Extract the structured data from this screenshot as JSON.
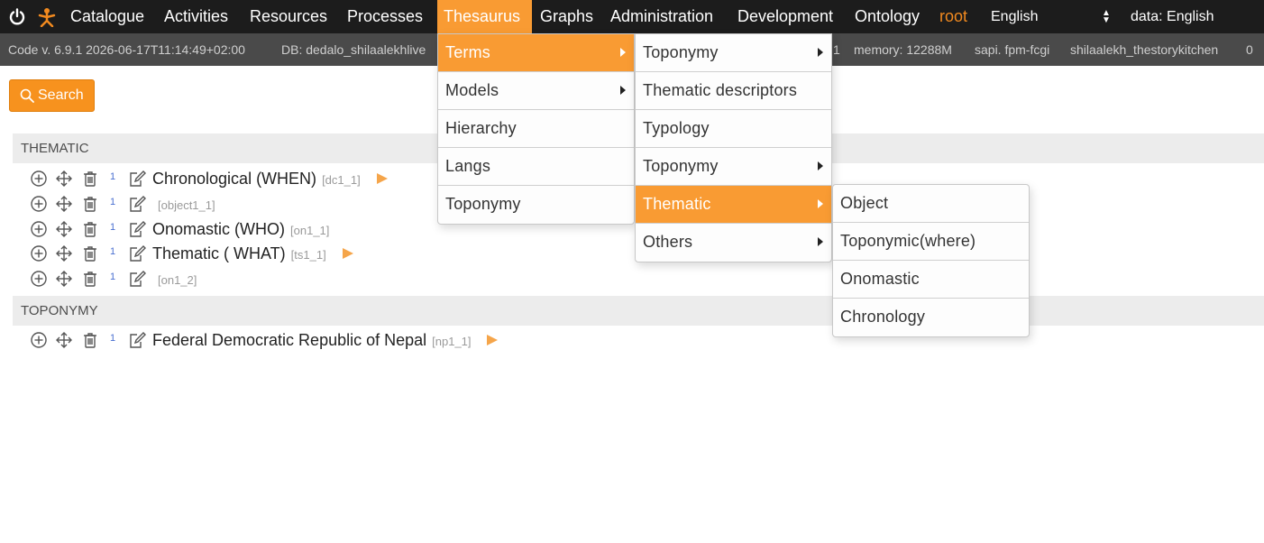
{
  "topbar": {
    "menu": [
      {
        "label": "Catalogue"
      },
      {
        "label": "Activities"
      },
      {
        "label": "Resources"
      },
      {
        "label": "Processes"
      },
      {
        "label": "Thesaurus"
      },
      {
        "label": "Graphs"
      },
      {
        "label": "Administration"
      },
      {
        "label": "Development"
      },
      {
        "label": "Ontology"
      }
    ],
    "user": "root",
    "app_language": "English",
    "data_language": "data: English"
  },
  "infobar": {
    "code": "Code v. 6.9.1 2026-06-17T11:14:49+02:00",
    "db": "DB: dedalo_shilaalekhlive",
    "db_suffix": "1",
    "memory": "memory: 12288M",
    "sapi": "sapi. fpm-fcgi",
    "entity": "shilaalekh_thestorykitchen",
    "counter": "0"
  },
  "search": {
    "label": "Search"
  },
  "sections": {
    "thematic": {
      "title": "THEMATIC",
      "rows": [
        {
          "count": "1",
          "term": "Chronological (WHEN)",
          "id": "[dc1_1]"
        },
        {
          "count": "1",
          "term": "",
          "id": "[object1_1]"
        },
        {
          "count": "1",
          "term": "Onomastic (WHO)",
          "id": "[on1_1]"
        },
        {
          "count": "1",
          "term": "Thematic ( WHAT)",
          "id": "[ts1_1]"
        },
        {
          "count": "1",
          "term": "",
          "id": "[on1_2]"
        }
      ]
    },
    "toponymy": {
      "title": "TOPONYMY",
      "rows": [
        {
          "count": "1",
          "term": "Federal Democratic Republic of Nepal",
          "id": "[np1_1]"
        }
      ]
    }
  },
  "menus": {
    "level1": [
      {
        "label": "Terms"
      },
      {
        "label": "Models"
      },
      {
        "label": "Hierarchy"
      },
      {
        "label": "Langs"
      },
      {
        "label": "Toponymy"
      }
    ],
    "level2": [
      {
        "label": "Toponymy"
      },
      {
        "label": "Thematic descriptors"
      },
      {
        "label": "Typology"
      },
      {
        "label": "Toponymy"
      },
      {
        "label": "Thematic"
      },
      {
        "label": "Others"
      }
    ],
    "level3": [
      {
        "label": "Object"
      },
      {
        "label": "Toponymic(where)"
      },
      {
        "label": "Onomastic"
      },
      {
        "label": "Chronology"
      }
    ]
  },
  "colors": {
    "accent": "#f99b33",
    "topbar": "#1c1c1c",
    "infobar": "#4a4a4a"
  },
  "icons": [
    "power-icon",
    "dedalo-logo-icon",
    "search-icon",
    "add-icon",
    "move-icon",
    "trash-icon",
    "edit-icon",
    "play-icon",
    "caret-right-icon",
    "select-arrows-icon"
  ]
}
